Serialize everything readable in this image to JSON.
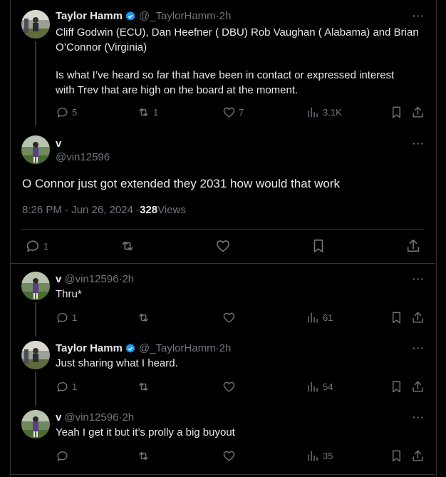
{
  "parent_tweet": {
    "name": "Taylor Hamm",
    "handle": "@_TaylorHamm",
    "time": "2h",
    "line1": "Cliff Godwin (ECU), Dan Heefner ( DBU) Rob Vaughan ( Alabama) and Brian",
    "line2": "O’Connor (Virginia)",
    "line3": "Is what I’ve heard so far that have been in contact or expressed interest",
    "line4": "with Trev that are high on the board at the moment.",
    "replies": "5",
    "reposts": "1",
    "likes": "7",
    "views": "3.1K"
  },
  "main_tweet": {
    "name": "v",
    "handle": "@vin12596",
    "text": "O Connor just got extended they 2031 how would that work",
    "timestamp": "8:26 PM · Jun 26, 2024 · ",
    "views_count": "328",
    "views_label": " Views",
    "replies": "1"
  },
  "replies": [
    {
      "name": "v",
      "handle": "@vin12596",
      "time": "2h",
      "text": "Thru*",
      "replies": "1",
      "views": "61",
      "verified": false
    },
    {
      "name": "Taylor Hamm",
      "handle": "@_TaylorHamm",
      "time": "2h",
      "text": "Just sharing what I heard.",
      "replies": "1",
      "views": "54",
      "verified": true
    },
    {
      "name": "v",
      "handle": "@vin12596",
      "time": "2h",
      "text": "Yeah I get it but it’s prolly a big buyout",
      "replies": "",
      "views": "35",
      "verified": false
    }
  ],
  "ui": {
    "more": "···",
    "dot": " · "
  },
  "colors": {
    "accent": "#1d9bf0",
    "muted": "#71767b",
    "text": "#e7e9ea",
    "border": "#2f3336"
  }
}
